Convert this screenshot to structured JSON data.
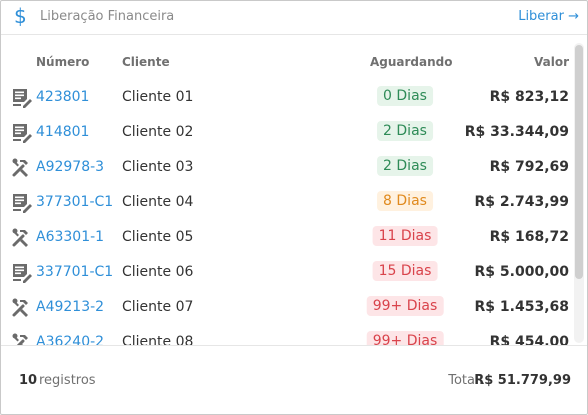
{
  "header": {
    "icon": "dollar-icon",
    "title": "Liberação Financeira",
    "action_label": "Liberar →"
  },
  "table": {
    "columns": {
      "numero": "Número",
      "cliente": "Cliente",
      "aguardando": "Aguardando",
      "valor": "Valor"
    },
    "rows": [
      {
        "type": "document-icon",
        "numero": "423801",
        "cliente": "Cliente 01",
        "aguardando": "0 Dias",
        "status": "green",
        "valor": "R$ 823,12"
      },
      {
        "type": "document-icon",
        "numero": "414801",
        "cliente": "Cliente 02",
        "aguardando": "2 Dias",
        "status": "green",
        "valor": "R$ 33.344,09"
      },
      {
        "type": "tools-icon",
        "numero": "A92978-3",
        "cliente": "Cliente 03",
        "aguardando": "2 Dias",
        "status": "green",
        "valor": "R$ 792,69"
      },
      {
        "type": "document-icon",
        "numero": "377301-C1",
        "cliente": "Cliente 04",
        "aguardando": "8 Dias",
        "status": "orange",
        "valor": "R$ 2.743,99"
      },
      {
        "type": "tools-icon",
        "numero": "A63301-1",
        "cliente": "Cliente 05",
        "aguardando": "11 Dias",
        "status": "red",
        "valor": "R$ 168,72"
      },
      {
        "type": "document-icon",
        "numero": "337701-C1",
        "cliente": "Cliente 06",
        "aguardando": "15 Dias",
        "status": "red",
        "valor": "R$ 5.000,00"
      },
      {
        "type": "tools-icon",
        "numero": "A49213-2",
        "cliente": "Cliente 07",
        "aguardando": "99+ Dias",
        "status": "red",
        "valor": "R$ 1.453,68"
      },
      {
        "type": "tools-icon",
        "numero": "A36240-2",
        "cliente": "Cliente 08",
        "aguardando": "99+ Dias",
        "status": "red",
        "valor": "R$ 454,00"
      }
    ]
  },
  "footer": {
    "count": "10",
    "count_label": "registros",
    "total_label": "Total:",
    "total_value": "R$ 51.779,99"
  },
  "colors": {
    "accent": "#2f8fd8",
    "green_bg": "#e6f4ea",
    "green_fg": "#2e8b57",
    "orange_bg": "#fff1df",
    "orange_fg": "#e08a1e",
    "red_bg": "#fde5e7",
    "red_fg": "#d9434b"
  }
}
